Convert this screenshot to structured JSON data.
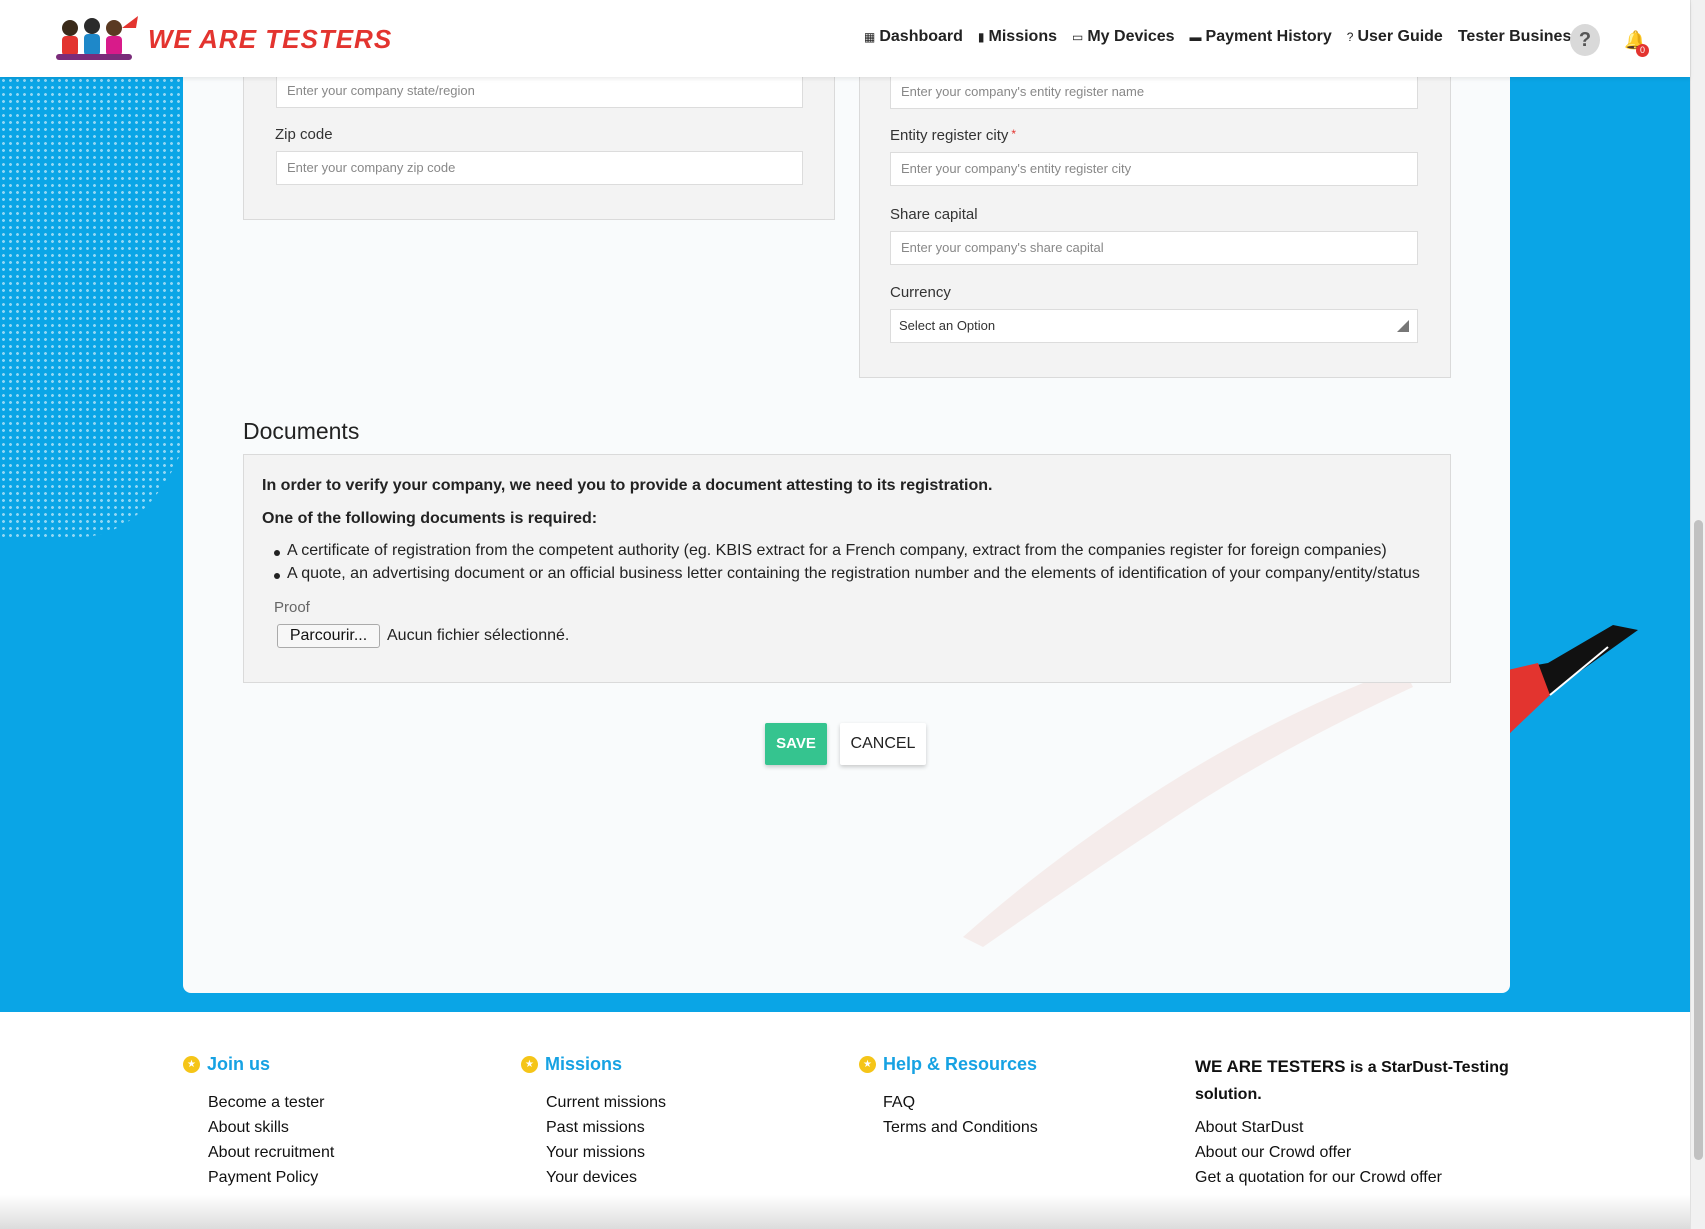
{
  "header": {
    "logo_text": "WE ARE TESTERS",
    "nav": [
      {
        "icon": "grid-icon",
        "label": "Dashboard"
      },
      {
        "icon": "bar-chart-icon",
        "label": "Missions"
      },
      {
        "icon": "laptop-icon",
        "label": "My Devices"
      },
      {
        "icon": "credit-card-icon",
        "label": "Payment History"
      },
      {
        "icon": "help-circle-icon",
        "label": "User Guide"
      },
      {
        "icon": "",
        "label": "Tester Business"
      }
    ],
    "notification_count": "0"
  },
  "form": {
    "state_placeholder": "Enter your company state/region",
    "zip_label": "Zip code",
    "zip_placeholder": "Enter your company zip code",
    "entity_name_placeholder": "Enter your company's entity register name",
    "entity_city_label": "Entity register city",
    "entity_city_required": "*",
    "entity_city_placeholder": "Enter your company's entity register city",
    "share_capital_label": "Share capital",
    "share_capital_placeholder": "Enter your company's share capital",
    "currency_label": "Currency",
    "currency_value": "Select an Option"
  },
  "documents": {
    "title": "Documents",
    "intro": "In order to verify your company, we need you to provide a document attesting to its registration.",
    "required": "One of the following documents is required:",
    "items": [
      "A certificate of registration from the competent authority (eg. KBIS extract for a French company, extract from the companies register for foreign companies)",
      "A quote, an advertising document or an official business letter containing the registration number and the elements of identification of your company/entity/status"
    ],
    "proof_label": "Proof",
    "browse_label": "Parcourir...",
    "no_file": "Aucun fichier sélectionné."
  },
  "actions": {
    "save": "SAVE",
    "cancel": "CANCEL"
  },
  "footer": {
    "join": {
      "title": "Join us",
      "links": [
        "Become a tester",
        "About skills",
        "About recruitment",
        "Payment Policy"
      ]
    },
    "missions": {
      "title": "Missions",
      "links": [
        "Current missions",
        "Past missions",
        "Your missions",
        "Your devices"
      ]
    },
    "help": {
      "title": "Help & Resources",
      "links": [
        "FAQ",
        "Terms and Conditions"
      ]
    },
    "about": {
      "title_strong": "WE ARE TESTERS",
      "title_rest": " is a StarDust-Testing solution.",
      "links": [
        "About StarDust",
        "About our Crowd offer",
        "Get a quotation for our Crowd offer"
      ]
    }
  },
  "colors": {
    "accent": "#0aa5e6",
    "save": "#35c48f",
    "brand_red": "#e3342f",
    "footer_title": "#16a2e3"
  }
}
